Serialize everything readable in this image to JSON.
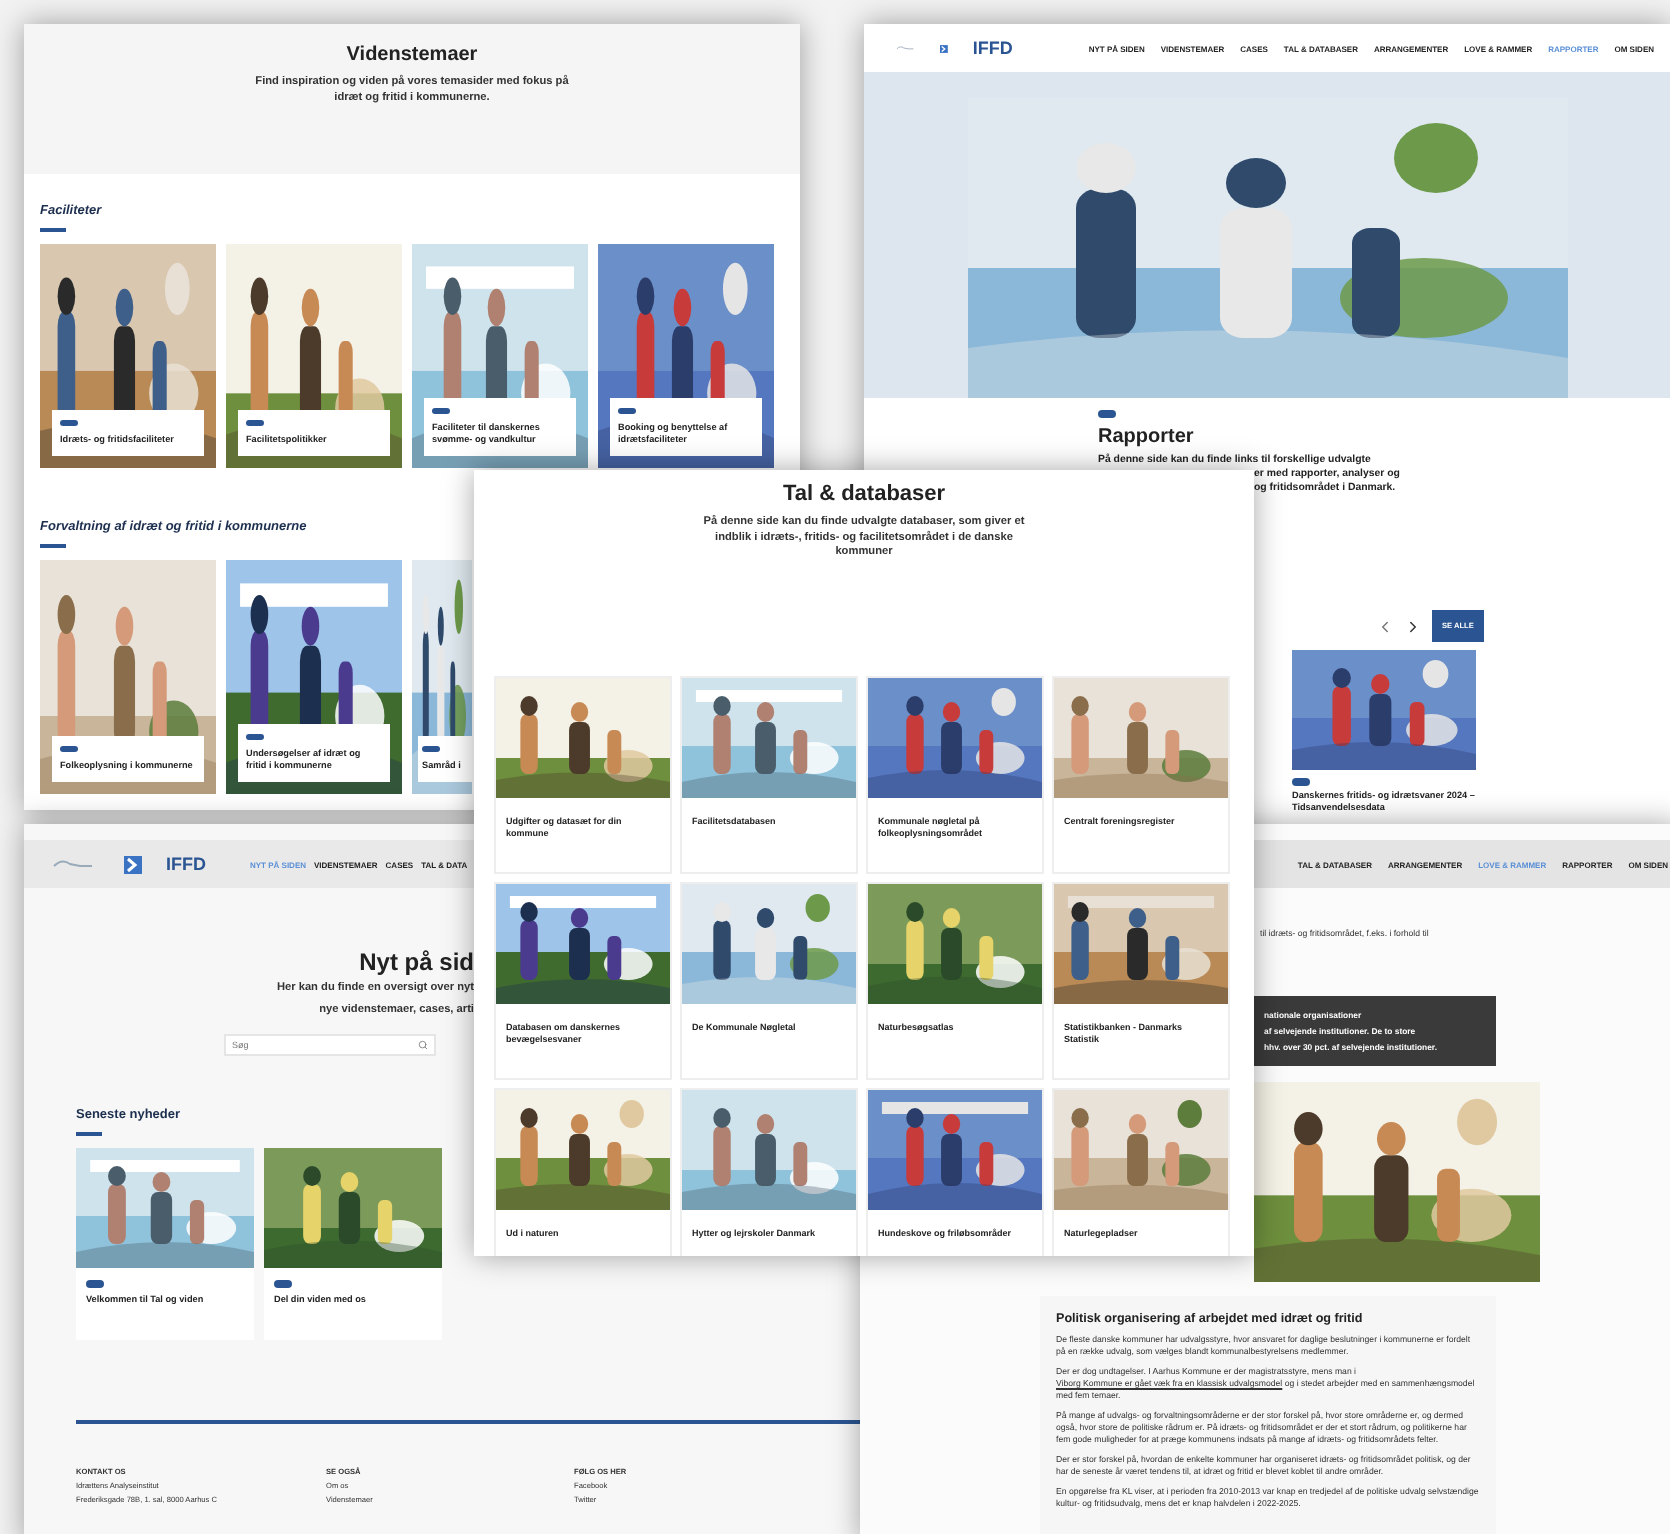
{
  "videnstemaer_page": {
    "title": "Videnstemaer",
    "subtitle": "Find inspiration og viden på vores temasider med fokus på idræt og fritid i kommunerne.",
    "sections": [
      {
        "heading": "Faciliteter",
        "cards": [
          {
            "title": "Idræts- og fritidsfaciliteter"
          },
          {
            "title": "Facilitetspolitikker"
          },
          {
            "title": "Faciliteter til danskernes svømme- og vandkultur"
          },
          {
            "title": "Booking og benyttelse af idrætsfaciliteter"
          }
        ]
      },
      {
        "heading": "Forvaltning af idræt og fritid i kommunerne",
        "cards": [
          {
            "title": "Folkeoplysning i kommunerne"
          },
          {
            "title": "Undersøgelser af idræt og fritid i kommunerne"
          },
          {
            "title": "Samråd i"
          }
        ]
      }
    ]
  },
  "rapporter_page": {
    "logo": "IFFD",
    "nav": [
      {
        "label": "NYT PÅ SIDEN",
        "selected": false
      },
      {
        "label": "VIDENSTEMAER",
        "selected": false
      },
      {
        "label": "CASES",
        "selected": false
      },
      {
        "label": "TAL & DATABASER",
        "selected": false
      },
      {
        "label": "ARRANGEMENTER",
        "selected": false
      },
      {
        "label": "LOVE & RAMMER",
        "selected": false
      },
      {
        "label": "RAPPORTER",
        "selected": true
      },
      {
        "label": "OM SIDEN",
        "selected": false
      }
    ],
    "title": "Rapporter",
    "intro": "På denne side kan du finde links til forskellige udvalgte",
    "intro_rest": [
      "er med rapporter, analyser og",
      "og fritidsområdet i Danmark."
    ],
    "button": "SE ALLE",
    "card": {
      "title": "Danskernes fritids- og idrætsvaner 2024 – Tidsanvendelsesdata"
    }
  },
  "nyt_page": {
    "logo": "IFFD",
    "nav": [
      {
        "label": "NYT PÅ SIDEN",
        "selected": true
      },
      {
        "label": "VIDENSTEMAER",
        "selected": false
      },
      {
        "label": "CASES",
        "selected": false
      },
      {
        "label": "TAL & DATA",
        "selected": false
      }
    ],
    "title": "Nyt på sid",
    "subtitle_lines": [
      "Her kan du finde en oversigt over nyt",
      "nye videnstemaer, cases, arti"
    ],
    "search": {
      "placeholder": "Søg"
    },
    "news_heading": "Seneste nyheder",
    "news": [
      {
        "title": "Velkommen til Tal og viden"
      },
      {
        "title": "Del din viden med os"
      }
    ],
    "footer": [
      {
        "heading": "KONTAKT OS",
        "lines": [
          "Idrættens Analyseinstitut",
          "Frederiksgade 78B, 1. sal, 8000 Aarhus C"
        ]
      },
      {
        "heading": "SE OGSÅ",
        "lines": [
          "Om os",
          "Videnstemaer"
        ]
      },
      {
        "heading": "FØLG OS HER",
        "lines": [
          "Facebook",
          "Twitter"
        ]
      }
    ]
  },
  "love_page": {
    "nav": [
      {
        "label": "TAL & DATABASER",
        "selected": false
      },
      {
        "label": "ARRANGEMENTER",
        "selected": false
      },
      {
        "label": "LOVE & RAMMER",
        "selected": true
      },
      {
        "label": "RAPPORTER",
        "selected": false
      },
      {
        "label": "OM SIDEN",
        "selected": false
      }
    ],
    "text_lines": [
      "til idræts- og fritidsområdet, f.eks. i forhold til"
    ],
    "notice_lines": [
      "nationale organisationer",
      "af selvejende institutioner. De to store",
      "hhv. over 30 pct. af selvejende institutioner."
    ],
    "article": {
      "title": "Politisk organisering af arbejdet med idræt og fritid",
      "paragraphs": [
        {
          "text": "De fleste danske kommuner har udvalgsstyre, hvor ansvaret for daglige beslutninger i kommunerne er fordelt på en række udvalg, som vælges blandt kommunalbestyrelsens medlemmer."
        },
        {
          "text": "Der er dog undtagelser. I Aarhus Kommune er der magistratsstyre, mens man i",
          "link": "Viborg Kommune er gået væk fra en klassisk udvalgsmodel",
          "after": "og i stedet arbejder med en sammenhængsmodel med fem temaer."
        },
        {
          "text": "På mange af udvalgs- og forvaltningsområderne er der stor forskel på, hvor store områderne er, og dermed også, hvor store de politiske rådrum er. På idræts- og fritidsområdet er der et stort rådrum, og politikerne har fem gode muligheder for at præge kommunens indsats på mange af idræts- og fritidsområdets felter."
        },
        {
          "text": "Der er stor forskel på, hvordan de enkelte kommuner har organiseret idræts- og fritidsområdet politisk, og der har de seneste år været tendens til, at idræt og fritid er blevet koblet til andre områder."
        },
        {
          "text": "En opgørelse fra KL viser, at i perioden fra 2010-2013 var knap en tredjedel af de politiske udvalg selvstændige kultur- og fritidsudvalg, mens det er knap halvdelen i 2022-2025."
        }
      ]
    }
  },
  "tal_page": {
    "title": "Tal & databaser",
    "subtitle": "På denne side kan du finde udvalgte databaser, som giver et indblik i idræts-, fritids- og facilitetsområdet i de danske kommuner",
    "cards": [
      {
        "title": "Udgifter og datasæt for din kommune"
      },
      {
        "title": "Facilitetsdatabasen"
      },
      {
        "title": "Kommunale nøgletal på folkeoplysningsområdet"
      },
      {
        "title": "Centralt foreningsregister"
      },
      {
        "title": "Databasen om danskernes bevægelsesvaner"
      },
      {
        "title": "De Kommunale Nøgletal"
      },
      {
        "title": "Naturbesøgsatlas"
      },
      {
        "title": "Statistikbanken - Danmarks Statistik"
      },
      {
        "title": "Ud i naturen"
      },
      {
        "title": "Hytter og lejrskoler Danmark"
      },
      {
        "title": "Hundeskove og friløbsområder"
      },
      {
        "title": "Naturlegepladser"
      }
    ]
  }
}
